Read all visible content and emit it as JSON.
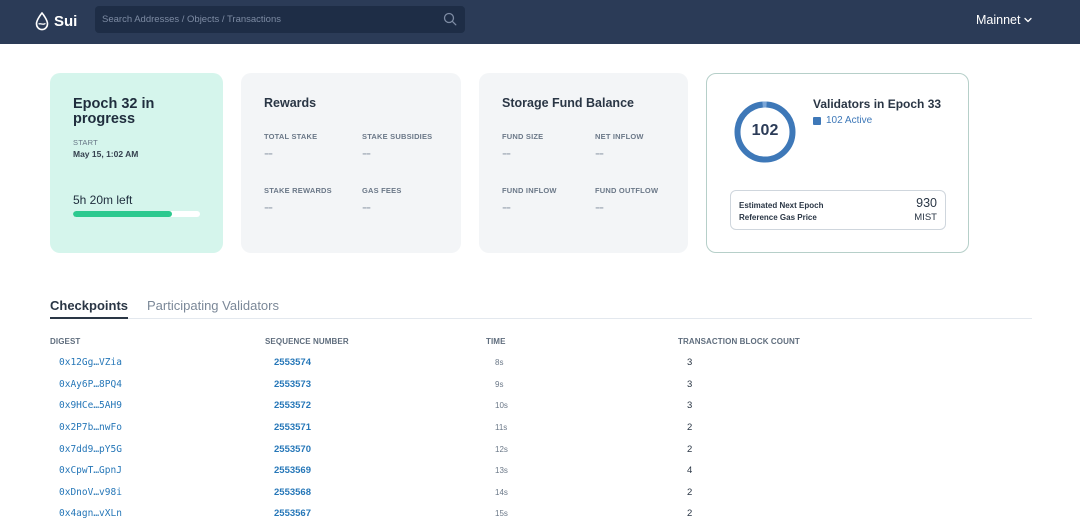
{
  "header": {
    "logo_text": "Sui",
    "search_placeholder": "Search Addresses / Objects / Transactions",
    "network": "Mainnet",
    "colors": {
      "bar": "#2b3b57",
      "search": "#1e2d46"
    }
  },
  "epoch_card": {
    "title": "Epoch 32 in progress",
    "start_label": "START",
    "start_date": "May 15, 1:02 AM",
    "time_left": "5h 20m left",
    "progress": 0.78
  },
  "rewards_card": {
    "title": "Rewards",
    "stats": [
      {
        "label": "TOTAL STAKE",
        "value": "--"
      },
      {
        "label": "STAKE SUBSIDIES",
        "value": "--"
      },
      {
        "label": "STAKE REWARDS",
        "value": "--"
      },
      {
        "label": "GAS FEES",
        "value": "--"
      }
    ]
  },
  "storage_card": {
    "title": "Storage Fund Balance",
    "stats": [
      {
        "label": "FUND SIZE",
        "value": "--"
      },
      {
        "label": "NET INFLOW",
        "value": "--"
      },
      {
        "label": "FUND INFLOW",
        "value": "--"
      },
      {
        "label": "FUND OUTFLOW",
        "value": "--"
      }
    ]
  },
  "validators_card": {
    "title": "Validators in Epoch 33",
    "count": "102",
    "active_label": "102 Active",
    "gas_label": "Estimated Next Epoch Reference Gas Price",
    "gas_value": "930",
    "gas_unit": "MIST",
    "accent": "#3e78b8"
  },
  "tabs": [
    {
      "label": "Checkpoints",
      "active": true
    },
    {
      "label": "Participating Validators",
      "active": false
    }
  ],
  "table": {
    "headers": [
      "DIGEST",
      "SEQUENCE NUMBER",
      "TIME",
      "TRANSACTION BLOCK COUNT"
    ],
    "rows": [
      {
        "digest": "0x12Gg…VZia",
        "seq": "2553574",
        "time": "8s",
        "count": "3"
      },
      {
        "digest": "0xAy6P…8PQ4",
        "seq": "2553573",
        "time": "9s",
        "count": "3"
      },
      {
        "digest": "0x9HCe…5AH9",
        "seq": "2553572",
        "time": "10s",
        "count": "3"
      },
      {
        "digest": "0x2P7b…nwFo",
        "seq": "2553571",
        "time": "11s",
        "count": "2"
      },
      {
        "digest": "0x7dd9…pY5G",
        "seq": "2553570",
        "time": "12s",
        "count": "2"
      },
      {
        "digest": "0xCpwT…GpnJ",
        "seq": "2553569",
        "time": "13s",
        "count": "4"
      },
      {
        "digest": "0xDnoV…v98i",
        "seq": "2553568",
        "time": "14s",
        "count": "2"
      },
      {
        "digest": "0x4agn…vXLn",
        "seq": "2553567",
        "time": "15s",
        "count": "2"
      }
    ]
  }
}
